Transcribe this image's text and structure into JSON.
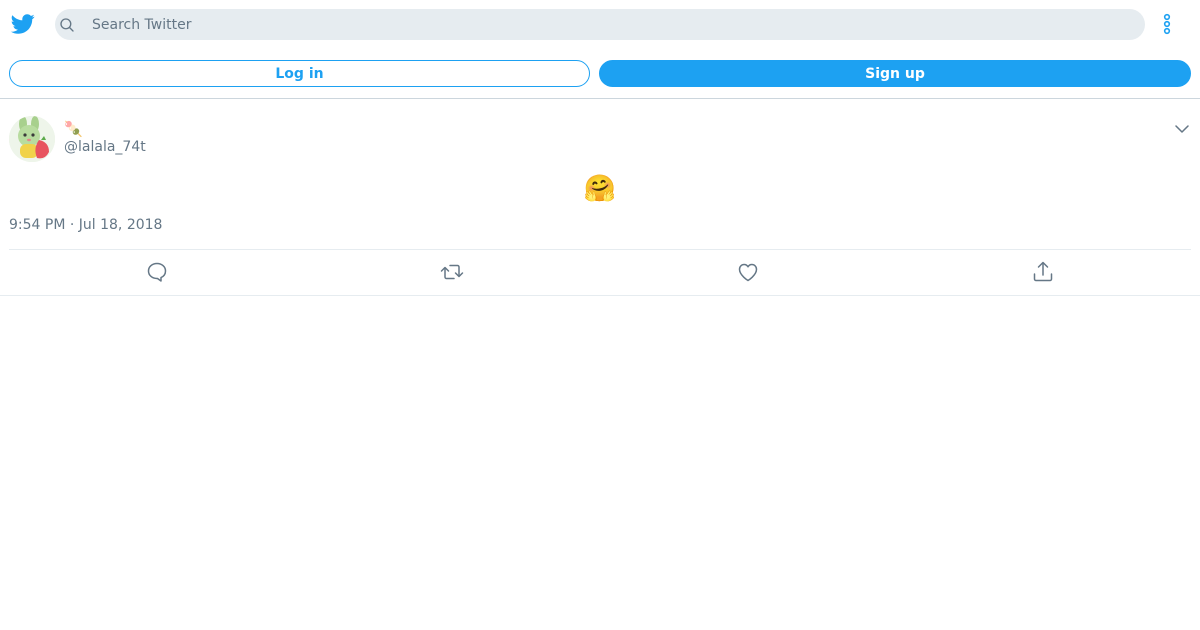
{
  "app": {
    "logo_icon": "twitter-bird-icon",
    "brand_color": "#1da1f2"
  },
  "header": {
    "search_placeholder": "Search Twitter",
    "search_icon": "search-icon",
    "more_icon": "more-vertical-icon"
  },
  "auth": {
    "login_label": "Log in",
    "signup_label": "Sign up"
  },
  "tweet": {
    "display_name": "🍡",
    "handle": "@lalala_74t",
    "text": "🤗",
    "timestamp": "9:54 PM · Jul 18, 2018",
    "avatar_icon": "avatar",
    "menu_icon": "chevron-down-icon",
    "actions": [
      {
        "name": "reply",
        "icon": "reply-icon"
      },
      {
        "name": "retweet",
        "icon": "retweet-icon"
      },
      {
        "name": "like",
        "icon": "heart-icon"
      },
      {
        "name": "share",
        "icon": "share-icon"
      }
    ]
  }
}
